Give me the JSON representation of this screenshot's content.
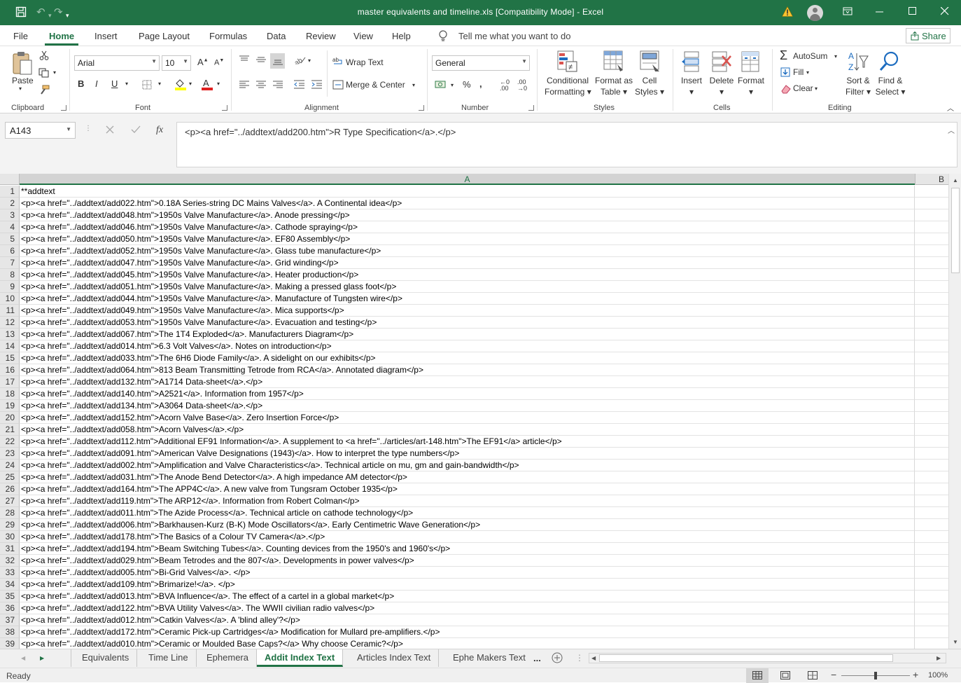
{
  "window": {
    "title": "master equivalents and timeline.xls  [Compatibility Mode]  -  Excel"
  },
  "menu": {
    "tabs": [
      "File",
      "Home",
      "Insert",
      "Page Layout",
      "Formulas",
      "Data",
      "Review",
      "View",
      "Help"
    ],
    "active": "Home",
    "tell_me": "Tell me what you want to do",
    "share": "Share"
  },
  "ribbon": {
    "clipboard": {
      "label": "Clipboard",
      "paste": "Paste"
    },
    "font": {
      "label": "Font",
      "family": "Arial",
      "size": "10"
    },
    "alignment": {
      "label": "Alignment",
      "wrap_text": "Wrap Text",
      "merge_center": "Merge & Center"
    },
    "number": {
      "label": "Number",
      "format": "General"
    },
    "styles": {
      "label": "Styles",
      "conditional": [
        "Conditional",
        "Formatting"
      ],
      "format_table": [
        "Format as",
        "Table"
      ],
      "cell_styles": [
        "Cell",
        "Styles"
      ]
    },
    "cells": {
      "label": "Cells",
      "insert": "Insert",
      "delete": "Delete",
      "format": "Format"
    },
    "editing": {
      "label": "Editing",
      "autosum": "AutoSum",
      "fill": "Fill",
      "clear": "Clear",
      "sort_filter": [
        "Sort &",
        "Filter"
      ],
      "find_select": [
        "Find &",
        "Select"
      ]
    }
  },
  "formula_bar": {
    "name_box": "A143",
    "fx": "fx",
    "content": "<p><a href=\"../addtext/add200.htm\">R Type Specification</a>.</p>"
  },
  "grid": {
    "columns": [
      "A",
      "B"
    ],
    "rows": [
      {
        "n": "1",
        "a": "**addtext"
      },
      {
        "n": "2",
        "a": "<p><a href=\"../addtext/add022.htm\">0.18A Series-string DC Mains Valves</a>. A Continental idea</p>"
      },
      {
        "n": "3",
        "a": "<p><a href=\"../addtext/add048.htm\">1950s Valve Manufacture</a>. Anode pressing</p>"
      },
      {
        "n": "4",
        "a": "<p><a href=\"../addtext/add046.htm\">1950s Valve Manufacture</a>. Cathode spraying</p>"
      },
      {
        "n": "5",
        "a": "<p><a href=\"../addtext/add050.htm\">1950s Valve Manufacture</a>. EF80 Assembly</p>"
      },
      {
        "n": "6",
        "a": "<p><a href=\"../addtext/add052.htm\">1950s Valve Manufacture</a>. Glass tube manufacture</p>"
      },
      {
        "n": "7",
        "a": "<p><a href=\"../addtext/add047.htm\">1950s Valve Manufacture</a>. Grid winding</p>"
      },
      {
        "n": "8",
        "a": "<p><a href=\"../addtext/add045.htm\">1950s Valve Manufacture</a>. Heater production</p>"
      },
      {
        "n": "9",
        "a": "<p><a href=\"../addtext/add051.htm\">1950s Valve Manufacture</a>. Making a pressed glass foot</p>"
      },
      {
        "n": "10",
        "a": "<p><a href=\"../addtext/add044.htm\">1950s Valve Manufacture</a>. Manufacture of Tungsten wire</p>"
      },
      {
        "n": "11",
        "a": "<p><a href=\"../addtext/add049.htm\">1950s Valve Manufacture</a>. Mica supports</p>"
      },
      {
        "n": "12",
        "a": "<p><a href=\"../addtext/add053.htm\">1950s Valve Manufacture</a>. Evacuation and testing</p>"
      },
      {
        "n": "13",
        "a": "<p><a href=\"../addtext/add067.htm\">The 1T4 Exploded</a>. Manufacturers Diagram</p>"
      },
      {
        "n": "14",
        "a": "<p><a href=\"../addtext/add014.htm\">6.3 Volt Valves</a>. Notes on introduction</p>"
      },
      {
        "n": "15",
        "a": "<p><a href=\"../addtext/add033.htm\">The 6H6 Diode Family</a>. A sidelight on our exhibits</p>"
      },
      {
        "n": "16",
        "a": "<p><a href=\"../addtext/add064.htm\">813 Beam Transmitting Tetrode from RCA</a>. Annotated diagram</p>"
      },
      {
        "n": "17",
        "a": "<p><a href=\"../addtext/add132.htm\">A1714 Data-sheet</a>.</p>"
      },
      {
        "n": "18",
        "a": "<p><a href=\"../addtext/add140.htm\">A2521</a>. Information from 1957</p>"
      },
      {
        "n": "19",
        "a": "<p><a href=\"../addtext/add134.htm\">A3064 Data-sheet</a>.</p>"
      },
      {
        "n": "20",
        "a": "<p><a href=\"../addtext/add152.htm\">Acorn Valve Base</a>. Zero Insertion Force</p>"
      },
      {
        "n": "21",
        "a": "<p><a href=\"../addtext/add058.htm\">Acorn Valves</a>.</p>"
      },
      {
        "n": "22",
        "a": "<p><a href=\"../addtext/add112.htm\">Additional EF91 Information</a>. A supplement to <a href=\"../articles/art-148.htm\">The EF91</a>  article</p>"
      },
      {
        "n": "23",
        "a": "<p><a href=\"../addtext/add091.htm\">American Valve Designations (1943)</a>. How to interpret the type numbers</p>"
      },
      {
        "n": "24",
        "a": "<p><a href=\"../addtext/add002.htm\">Amplification and Valve Characteristics</a>. Technical article on mu, gm and gain-bandwidth</p>"
      },
      {
        "n": "25",
        "a": "<p><a href=\"../addtext/add031.htm\">The Anode Bend Detector</a>. A high impedance AM detector</p>"
      },
      {
        "n": "26",
        "a": "<p><a href=\"../addtext/add164.htm\">The APP4C</a>. A new valve from Tungsram October 1935</p>"
      },
      {
        "n": "27",
        "a": "<p><a href=\"../addtext/add119.htm\">The ARP12</a>. Information from Robert Colman</p>"
      },
      {
        "n": "28",
        "a": "<p><a href=\"../addtext/add011.htm\">The Azide Process</a>. Technical article on cathode technology</p>"
      },
      {
        "n": "29",
        "a": "<p><a href=\"../addtext/add006.htm\">Barkhausen-Kurz (B-K) Mode Oscillators</a>. Early Centimetric Wave Generation</p>"
      },
      {
        "n": "30",
        "a": "<p><a href=\"../addtext/add178.htm\">The Basics of a Colour TV Camera</a>.</p>"
      },
      {
        "n": "31",
        "a": "<p><a href=\"../addtext/add194.htm\">Beam Switching Tubes</a>. Counting devices from the 1950's and 1960's</p>"
      },
      {
        "n": "32",
        "a": "<p><a href=\"../addtext/add029.htm\">Beam Tetrodes and the 807</a>. Developments in power valves</p>"
      },
      {
        "n": "33",
        "a": "<p><a href=\"../addtext/add005.htm\">Bi-Grid Valves</a>. </p>"
      },
      {
        "n": "34",
        "a": "<p><a href=\"../addtext/add109.htm\">Brimarize!</a>. </p>"
      },
      {
        "n": "35",
        "a": "<p><a href=\"../addtext/add013.htm\">BVA Influence</a>. The effect of a cartel in a global market</p>"
      },
      {
        "n": "36",
        "a": "<p><a href=\"../addtext/add122.htm\">BVA Utility Valves</a>. The WWII civilian radio valves</p>"
      },
      {
        "n": "37",
        "a": "<p><a href=\"../addtext/add012.htm\">Catkin Valves</a>. A 'blind alley'?</p>"
      },
      {
        "n": "38",
        "a": "<p><a href=\"../addtext/add172.htm\">Ceramic Pick-up Cartridges</a> Modification for Mullard pre-amplifiers.</p>"
      },
      {
        "n": "39",
        "a": "<p><a href=\"../addtext/add010.htm\">Ceramic or Moulded Base Caps?</a> Why choose Ceramic?</p>"
      }
    ]
  },
  "sheets": {
    "tabs": [
      "Equivalents",
      "Time Line",
      "Ephemera",
      "Addit Index Text",
      "Articles Index Text",
      "Ephe Makers Text"
    ],
    "active": "Addit Index Text",
    "more": "..."
  },
  "status": {
    "text": "Ready",
    "zoom": "100%",
    "zoom_fraction": 0.5
  },
  "colors": {
    "accent": "#217346",
    "ribbon_bg": "#ffffff",
    "header_bg": "#e6e6e6"
  }
}
